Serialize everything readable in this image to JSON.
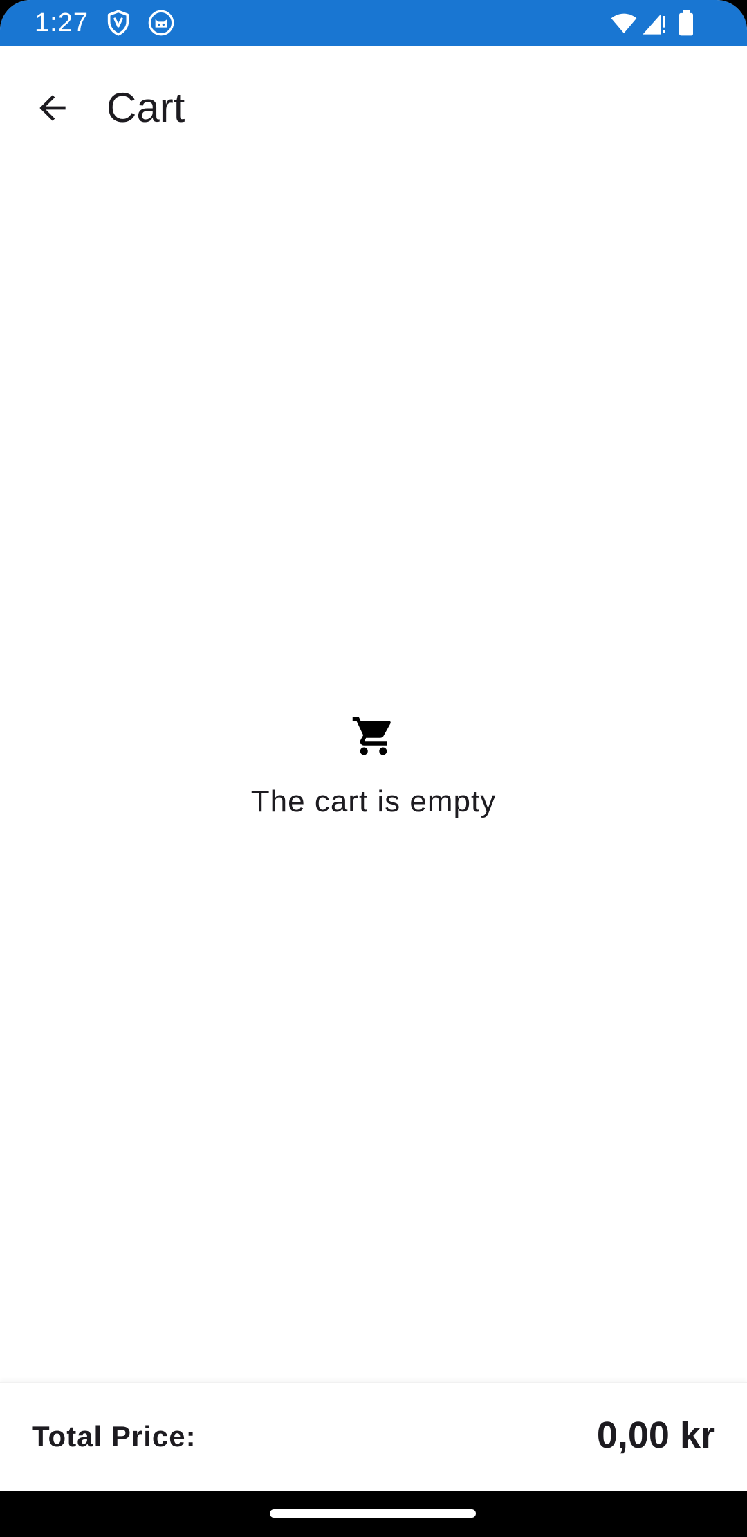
{
  "status_bar": {
    "time": "1:27",
    "left_icons": [
      "shield-icon",
      "cat-face-icon"
    ],
    "right_icons": [
      "wifi-icon",
      "cellular-signal-icon",
      "battery-icon"
    ],
    "background_color": "#1976d2"
  },
  "app_bar": {
    "back_icon": "arrow-back-icon",
    "title": "Cart"
  },
  "empty_state": {
    "icon": "shopping-cart-icon",
    "message": "The cart is empty"
  },
  "footer": {
    "total_label": "Total Price:",
    "total_value": "0,00 kr"
  }
}
